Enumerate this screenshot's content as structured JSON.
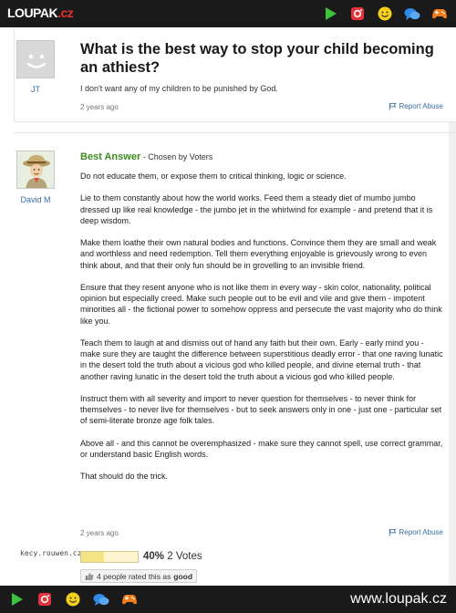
{
  "header": {
    "logo_main": "LOUPAK",
    "logo_tld": ".cz"
  },
  "question": {
    "user": "JT",
    "title": "What is the best way to stop your child becoming an athiest?",
    "description": "I don't want any of my children to be punished by God.",
    "time": "2 years ago",
    "report": "Report Abuse"
  },
  "answer": {
    "user": "David M",
    "best_label": "Best Answer",
    "chosen_by": " - Chosen by Voters",
    "paragraphs": [
      "Do not educate them, or expose them to critical thinking, logic or science.",
      "Lie to them constantly about how the world works. Feed them a steady diet of mumbo jumbo dressed up like real knowledge - the jumbo jet in the whirlwind for example - and pretend that it is deep wisdom.",
      "Make them loathe their own natural bodies and functions. Convince them they are small and weak and worthless and need redemption. Tell them everything enjoyable is grievously wrong to even think about, and that their only fun should be in grovelling to an invisible friend.",
      "Ensure that they resent anyone who is not like them in every way - skin color, nationality, political opinion but especially creed. Make such people out to be evil and vile and give them - impotent minorities all - the fictional power to somehow oppress and persecute the vast majority who do think like you.",
      "Teach them to laugh at and dismiss out of hand any faith but their own. Early - early mind you - make sure they are taught the difference between superstitious deadly error - that one raving lunatic in the desert told the truth about a vicious god who killed people, and divine eternal truth - that another raving lunatic in the desert told the truth about a vicious god who killed people.",
      "Instruct them with all severity and import to never question for themselves - to never think for themselves - to never live for themselves - but to seek answers only in one - just one - particular set of semi-literate bronze age folk tales.",
      "Above all - and this cannot be overemphasized - make sure they cannot spell, use correct grammar, or understand basic English words.",
      "That should do the trick."
    ],
    "time": "2 years ago",
    "report": "Report Abuse"
  },
  "rating": {
    "percent_value": 40,
    "percent_text": "40%",
    "votes": "2 Votes",
    "rated_prefix": "4 people rated this as",
    "rated_word": "good"
  },
  "watermark": "kecy.rouwen.cz",
  "footer": {
    "site": "www.loupak.cz"
  },
  "colors": {
    "bar": "#1a1a1a",
    "best_answer": "#3c8c1e",
    "link": "#3b6ea5",
    "logo_accent": "#e8312a"
  },
  "icons": [
    "play-icon",
    "instagram-icon",
    "smiley-icon",
    "chat-icon",
    "gamepad-icon"
  ]
}
